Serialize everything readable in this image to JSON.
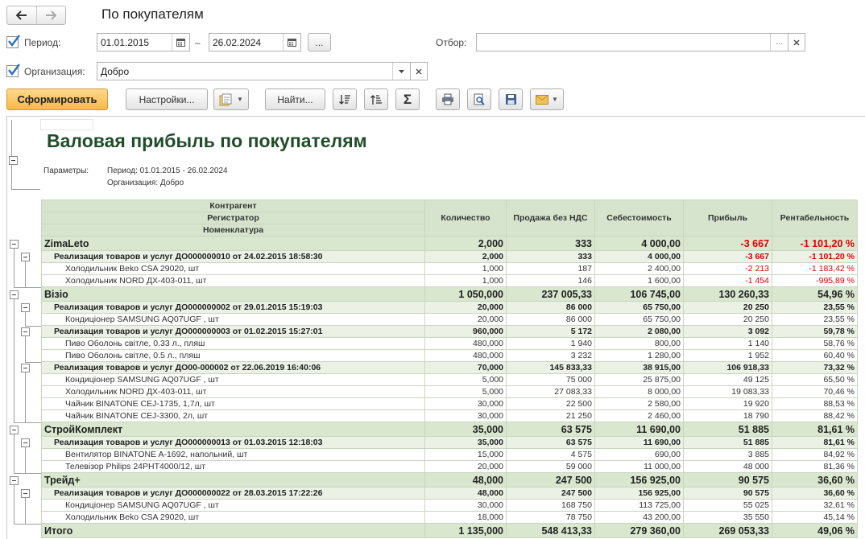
{
  "header": {
    "back_icon": "arrow-left-icon",
    "forward_icon": "arrow-right-icon",
    "title": "По покупателям"
  },
  "filters": {
    "period_label": "Период:",
    "period_checked": true,
    "date_from": "01.01.2015",
    "date_sep": "–",
    "date_to": "26.02.2024",
    "period_more": "...",
    "selection_label": "Отбор:",
    "selection_value": "",
    "selection_more": "...",
    "org_label": "Организация:",
    "org_checked": true,
    "org_value": "Добро"
  },
  "toolbar": {
    "generate": "Сформировать",
    "settings": "Настройки...",
    "find": "Найти..."
  },
  "report": {
    "title": "Валовая прибыль по покупателям",
    "params_label": "Параметры:",
    "params": [
      "Период: 01.01.2015 - 26.02.2024",
      "Организация: Добро"
    ],
    "group_headers": [
      "Контрагент",
      "Регистратор",
      "Номенклатура"
    ],
    "columns": [
      "Количество",
      "Продажа без НДС",
      "Себестоимость",
      "Прибыль",
      "Рентабельность"
    ],
    "rows": [
      {
        "level": 1,
        "name": "ZimaLeto",
        "qty": "2,000",
        "sales": "333",
        "cost": "4 000,00",
        "profit": "-3 667",
        "margin": "-1 101,20 %",
        "neg": true
      },
      {
        "level": 2,
        "name": "Реализация товаров и услуг ДО000000010 от 24.02.2015 18:58:30",
        "qty": "2,000",
        "sales": "333",
        "cost": "4 000,00",
        "profit": "-3 667",
        "margin": "-1 101,20 %",
        "neg": true
      },
      {
        "level": 3,
        "name": "Холодильник Beko CSA 29020, шт",
        "qty": "1,000",
        "sales": "187",
        "cost": "2 400,00",
        "profit": "-2 213",
        "margin": "-1 183,42 %",
        "neg": true
      },
      {
        "level": 3,
        "name": "Холодильник NORD ДХ-403-011, шт",
        "qty": "1,000",
        "sales": "146",
        "cost": "1 600,00",
        "profit": "-1 454",
        "margin": "-995,89 %",
        "neg": true
      },
      {
        "level": 1,
        "name": "Візіо",
        "qty": "1 050,000",
        "sales": "237 005,33",
        "cost": "106 745,00",
        "profit": "130 260,33",
        "margin": "54,96 %"
      },
      {
        "level": 2,
        "name": "Реализация товаров и услуг ДО000000002 от 29.01.2015 15:19:03",
        "qty": "20,000",
        "sales": "86 000",
        "cost": "65 750,00",
        "profit": "20 250",
        "margin": "23,55 %"
      },
      {
        "level": 3,
        "name": "Кондиціонер SAMSUNG AQ07UGF , шт",
        "qty": "20,000",
        "sales": "86 000",
        "cost": "65 750,00",
        "profit": "20 250",
        "margin": "23,55 %"
      },
      {
        "level": 2,
        "name": "Реализация товаров и услуг ДО000000003 от 01.02.2015 15:27:01",
        "qty": "960,000",
        "sales": "5 172",
        "cost": "2 080,00",
        "profit": "3 092",
        "margin": "59,78 %"
      },
      {
        "level": 3,
        "name": "Пиво Оболонь світле, 0.33 л., пляш",
        "qty": "480,000",
        "sales": "1 940",
        "cost": "800,00",
        "profit": "1 140",
        "margin": "58,76 %"
      },
      {
        "level": 3,
        "name": "Пиво Оболонь світле, 0.5 л., пляш",
        "qty": "480,000",
        "sales": "3 232",
        "cost": "1 280,00",
        "profit": "1 952",
        "margin": "60,40 %"
      },
      {
        "level": 2,
        "name": "Реализация товаров и услуг ДО00-000002 от 22.06.2019 16:40:06",
        "qty": "70,000",
        "sales": "145 833,33",
        "cost": "38 915,00",
        "profit": "106 918,33",
        "margin": "73,32 %"
      },
      {
        "level": 3,
        "name": "Кондиціонер SAMSUNG AQ07UGF , шт",
        "qty": "5,000",
        "sales": "75 000",
        "cost": "25 875,00",
        "profit": "49 125",
        "margin": "65,50 %"
      },
      {
        "level": 3,
        "name": "Холодильник NORD ДХ-403-011, шт",
        "qty": "5,000",
        "sales": "27 083,33",
        "cost": "8 000,00",
        "profit": "19 083,33",
        "margin": "70,46 %"
      },
      {
        "level": 3,
        "name": "Чайник BINATONE CEJ-1735,  1,7л, шт",
        "qty": "30,000",
        "sales": "22 500",
        "cost": "2 580,00",
        "profit": "19 920",
        "margin": "88,53 %"
      },
      {
        "level": 3,
        "name": "Чайник BINATONE CEJ-3300,  2л, шт",
        "qty": "30,000",
        "sales": "21 250",
        "cost": "2 460,00",
        "profit": "18 790",
        "margin": "88,42 %"
      },
      {
        "level": 1,
        "name": "СтройКомплект",
        "qty": "35,000",
        "sales": "63 575",
        "cost": "11 690,00",
        "profit": "51 885",
        "margin": "81,61 %"
      },
      {
        "level": 2,
        "name": "Реализация товаров и услуг ДО000000013 от 01.03.2015 12:18:03",
        "qty": "35,000",
        "sales": "63 575",
        "cost": "11 690,00",
        "profit": "51 885",
        "margin": "81,61 %"
      },
      {
        "level": 3,
        "name": "Вентилятор BINATONE A-1692, напольний, шт",
        "qty": "15,000",
        "sales": "4 575",
        "cost": "690,00",
        "profit": "3 885",
        "margin": "84,92 %"
      },
      {
        "level": 3,
        "name": "Телевізор Philips 24PHT4000/12, шт",
        "qty": "20,000",
        "sales": "59 000",
        "cost": "11 000,00",
        "profit": "48 000",
        "margin": "81,36 %"
      },
      {
        "level": 1,
        "name": "Трейд+",
        "qty": "48,000",
        "sales": "247 500",
        "cost": "156 925,00",
        "profit": "90 575",
        "margin": "36,60 %"
      },
      {
        "level": 2,
        "name": "Реализация товаров и услуг ДО000000022 от 28.03.2015 17:22:26",
        "qty": "48,000",
        "sales": "247 500",
        "cost": "156 925,00",
        "profit": "90 575",
        "margin": "36,60 %"
      },
      {
        "level": 3,
        "name": "Кондиціонер SAMSUNG AQ07UGF , шт",
        "qty": "30,000",
        "sales": "168 750",
        "cost": "113 725,00",
        "profit": "55 025",
        "margin": "32,61 %"
      },
      {
        "level": 3,
        "name": "Холодильник Beko CSA 29020, шт",
        "qty": "18,000",
        "sales": "78 750",
        "cost": "43 200,00",
        "profit": "35 550",
        "margin": "45,14 %"
      }
    ],
    "total": {
      "name": "Итого",
      "qty": "1 135,000",
      "sales": "548 413,33",
      "cost": "279 360,00",
      "profit": "269 053,33",
      "margin": "49,06 %"
    }
  },
  "colors": {
    "accent": "#f5b84a",
    "negative": "#e00000",
    "title": "#1f4d2a",
    "header_bg": "#d7e4cd"
  }
}
